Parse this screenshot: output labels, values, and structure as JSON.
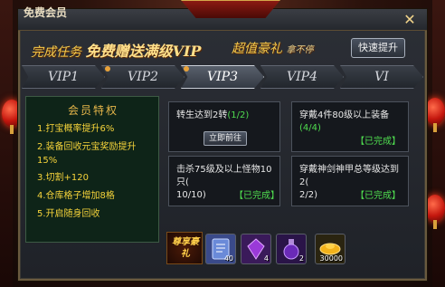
{
  "window": {
    "title": "免费会员",
    "close_label": "✕"
  },
  "banner": {
    "left_prefix": "完成任务",
    "left_highlight": "免费赠送满级VIP",
    "right_main": "超值豪礼",
    "right_small": "拿不停",
    "quick_button": "快速提升"
  },
  "tabs": [
    {
      "label": "VIP1",
      "active": false
    },
    {
      "label": "VIP2",
      "active": false
    },
    {
      "label": "VIP3",
      "active": true
    },
    {
      "label": "VIP4",
      "active": false
    },
    {
      "label": "VI",
      "active": false
    }
  ],
  "benefits": {
    "title": "会员特权",
    "items": [
      "1.打宝概率提升6%",
      "2.装备回收元宝奖励提升15%",
      "3.切割+120",
      "4.仓库格子增加8格",
      "5.开启随身回收"
    ]
  },
  "tasks": [
    {
      "text": "转生达到2转",
      "progress": "(1/2)",
      "action": "立即前往"
    },
    {
      "text": "穿戴4件80级以上装备",
      "progress": "(4/4)",
      "status": "【已完成】"
    },
    {
      "text_line1": "击杀75级及以上怪物10只(",
      "text_line2": "10/10)",
      "status": "【已完成】"
    },
    {
      "text_line1": "穿戴神剑神甲总等级达到2(",
      "text_line2": "2/2)",
      "status": "【已完成】"
    }
  ],
  "rewards": {
    "seal_text": "尊享豪礼",
    "items": [
      {
        "name": "scroll-item",
        "count": "40",
        "color": "#3a4a8a"
      },
      {
        "name": "purple-gem-item",
        "count": "4",
        "color": "#3a1a5a"
      },
      {
        "name": "purple-potion-item",
        "count": "2",
        "color": "#2a1448"
      },
      {
        "name": "gold-ingot-item",
        "count": "30000",
        "color": "#2a2410"
      }
    ]
  }
}
